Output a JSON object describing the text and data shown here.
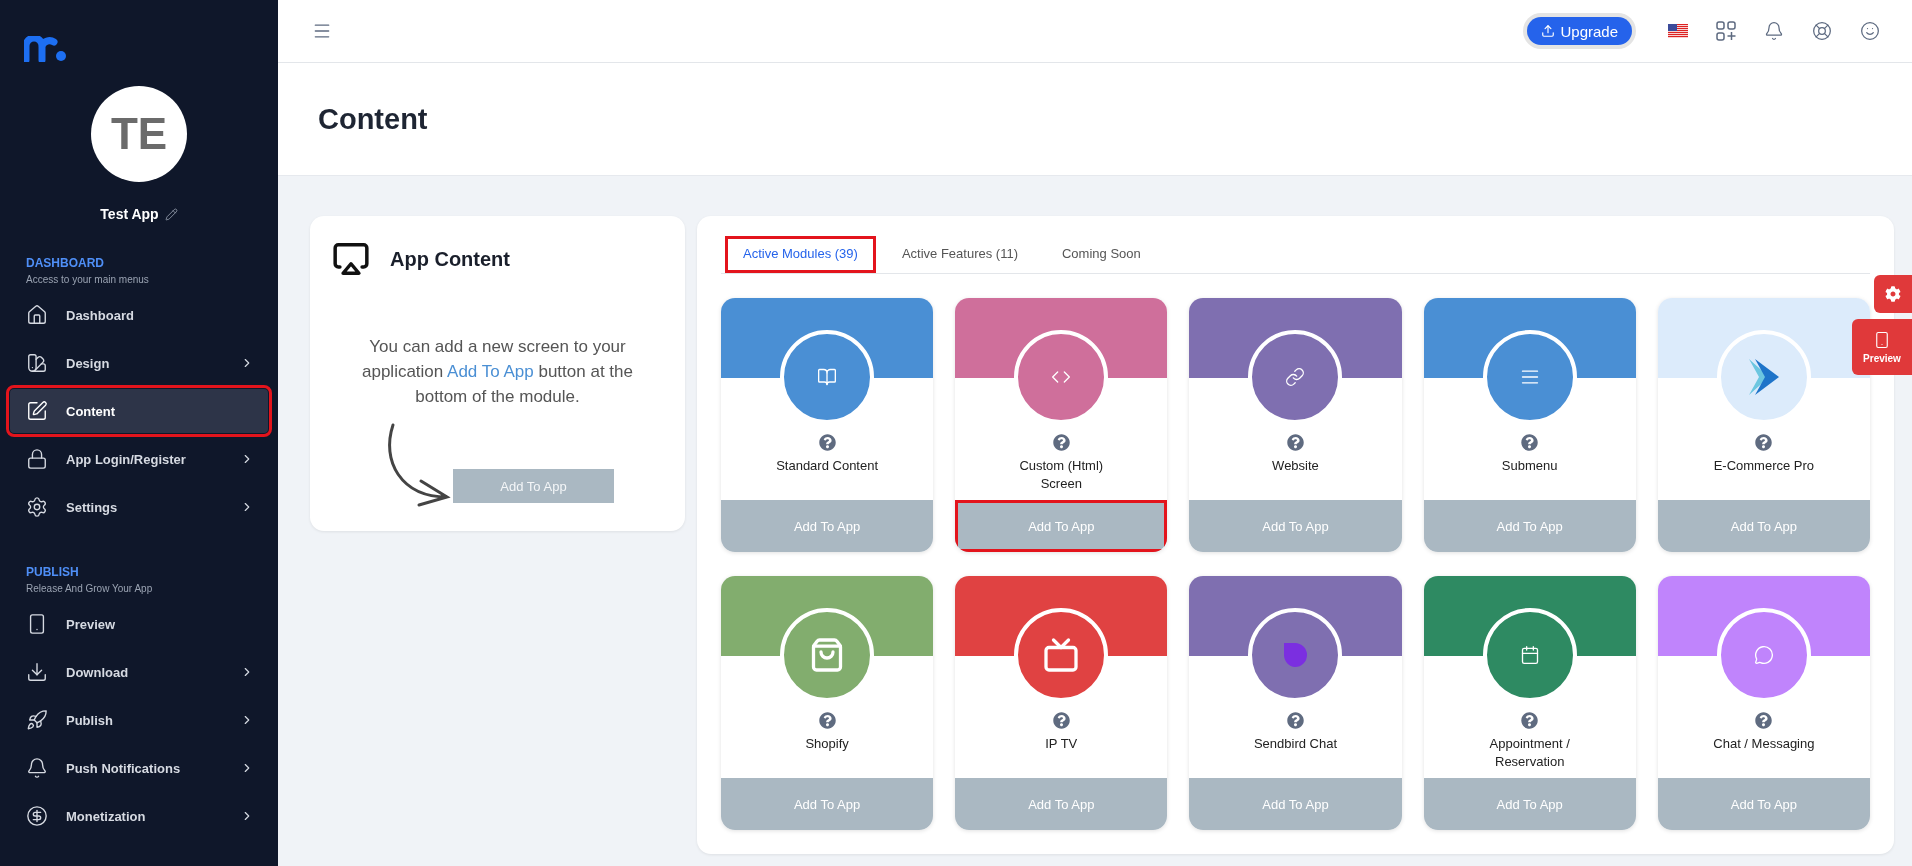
{
  "sidebar": {
    "app_initials": "TE",
    "app_name": "Test App",
    "sections": [
      {
        "title": "DASHBOARD",
        "subtitle": "Access to your main menus",
        "items": [
          {
            "label": "Dashboard",
            "selected": false,
            "has_submenu": false,
            "highlighted": false
          },
          {
            "label": "Design",
            "selected": false,
            "has_submenu": true,
            "highlighted": false
          },
          {
            "label": "Content",
            "selected": true,
            "has_submenu": false,
            "highlighted": true
          },
          {
            "label": "App Login/Register",
            "selected": false,
            "has_submenu": true,
            "highlighted": false
          },
          {
            "label": "Settings",
            "selected": false,
            "has_submenu": true,
            "highlighted": false
          }
        ]
      },
      {
        "title": "PUBLISH",
        "subtitle": "Release And Grow Your App",
        "items": [
          {
            "label": "Preview",
            "selected": false,
            "has_submenu": false,
            "highlighted": false
          },
          {
            "label": "Download",
            "selected": false,
            "has_submenu": true,
            "highlighted": false
          },
          {
            "label": "Publish",
            "selected": false,
            "has_submenu": true,
            "highlighted": false
          },
          {
            "label": "Push Notifications",
            "selected": false,
            "has_submenu": true,
            "highlighted": false
          },
          {
            "label": "Monetization",
            "selected": false,
            "has_submenu": true,
            "highlighted": false
          }
        ]
      }
    ]
  },
  "topbar": {
    "upgrade_button": "Upgrade"
  },
  "page_title": "Content",
  "app_content": {
    "title": "App Content",
    "hint": "You can add a new screen to your application **Add To App** button at the bottom of the module.",
    "button": "Add To App"
  },
  "tabs": [
    {
      "label": "Active Modules (39)",
      "selected": true,
      "highlighted": true
    },
    {
      "label": "Active Features (11)",
      "selected": false,
      "highlighted": false
    },
    {
      "label": "Coming Soon",
      "selected": false,
      "highlighted": false
    }
  ],
  "modules": [
    {
      "name": "Standard Content",
      "color": "#4a8fd4",
      "button": "Add To App",
      "highlighted": false
    },
    {
      "name": "Custom (Html) Screen",
      "color": "#cf6f9b",
      "button": "Add To App",
      "highlighted": true
    },
    {
      "name": "Website",
      "color": "#7f6fb0",
      "button": "Add To App",
      "highlighted": false
    },
    {
      "name": "Submenu",
      "color": "#4a8fd4",
      "button": "Add To App",
      "highlighted": false
    },
    {
      "name": "E-Commerce Pro",
      "color": "#dcebfb",
      "button": "Add To App",
      "highlighted": false
    },
    {
      "name": "Shopify",
      "color": "#82ad6e",
      "button": "Add To App",
      "highlighted": false
    },
    {
      "name": "IP TV",
      "color": "#e04242",
      "button": "Add To App",
      "highlighted": false
    },
    {
      "name": "Sendbird Chat",
      "color": "#7f6fb0",
      "button": "Add To App",
      "highlighted": false
    },
    {
      "name": "Appointment / Reservation",
      "color": "#2e8a62",
      "button": "Add To App",
      "highlighted": false
    },
    {
      "name": "Chat / Messaging",
      "color": "#c084fc",
      "button": "Add To App",
      "highlighted": false
    }
  ],
  "floating": {
    "preview_label": "Preview"
  }
}
